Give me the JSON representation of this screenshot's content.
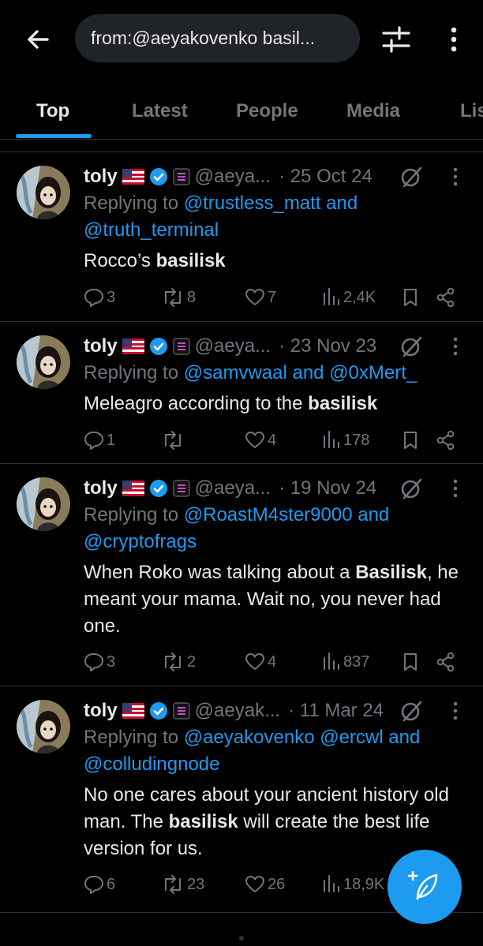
{
  "search": {
    "query": "from:@aeyakovenko basil..."
  },
  "tabs": [
    {
      "label": "Top",
      "active": true
    },
    {
      "label": "Latest"
    },
    {
      "label": "People"
    },
    {
      "label": "Media"
    },
    {
      "label": "Lis"
    }
  ],
  "tweets": [
    {
      "name": "toly",
      "handle": "@aeya...",
      "date": "· 25 Oct 24",
      "reply_prefix": "Replying to ",
      "mentions_line1": "@trustless_matt and",
      "mentions_line2": "@truth_terminal",
      "text_before": "Rocco’s ",
      "text_bold": "basilisk",
      "text_after": "",
      "replies": "3",
      "reposts": "8",
      "likes": "7",
      "views": "2,4K"
    },
    {
      "name": "toly",
      "handle": "@aeya...",
      "date": "· 23 Nov 23",
      "reply_prefix": "Replying to ",
      "mentions_line1": "@samvwaal and @0xMert_",
      "text_before": "Meleagro according to the ",
      "text_bold": "basilisk",
      "text_after": "",
      "replies": "1",
      "reposts": "",
      "likes": "4",
      "views": "178"
    },
    {
      "name": "toly",
      "handle": "@aeya...",
      "date": "· 19 Nov 24",
      "reply_prefix": "Replying to ",
      "mentions_line1": "@RoastM4ster9000 and",
      "mentions_line2": "@cryptofrags",
      "text_before": "When Roko was talking about a ",
      "text_bold": "Basilisk",
      "text_after": ", he meant your mama.  Wait no, you never had one.",
      "replies": "3",
      "reposts": "2",
      "likes": "4",
      "views": "837"
    },
    {
      "name": "toly",
      "handle": "@aeyak...",
      "date": "· 11 Mar 24",
      "reply_prefix": "Replying to ",
      "mentions_line1": "@aeyakovenko @ercwl and",
      "mentions_line2": "@colludingnode",
      "text_before": "No one cares about your ancient history old man. The ",
      "text_bold": "basilisk",
      "text_after": " will create the best life version for us.",
      "replies": "6",
      "reposts": "23",
      "likes": "26",
      "views": "18,9K"
    }
  ],
  "colors": {
    "accent": "#1d9bf0",
    "muted": "#71767b",
    "text": "#e7e9ea",
    "background": "#000000"
  },
  "icons": [
    "back-arrow-icon",
    "filter-sliders-icon",
    "more-vertical-icon",
    "verified-badge-icon",
    "us-flag-icon",
    "grok-icon",
    "reply-icon",
    "repost-icon",
    "like-icon",
    "views-icon",
    "bookmark-icon",
    "share-icon",
    "compose-icon"
  ]
}
